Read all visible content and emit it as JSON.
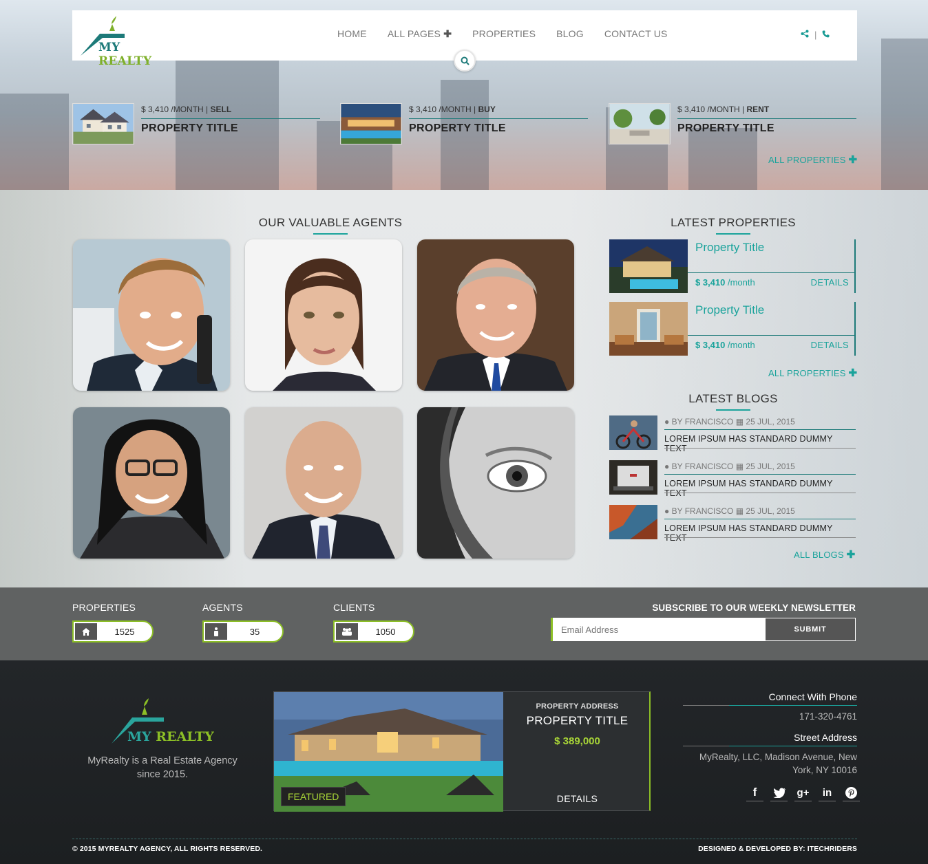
{
  "brand": {
    "my": "MY",
    "realty": "REALTY"
  },
  "nav": {
    "home": "HOME",
    "all_pages": "ALL PAGES",
    "properties": "PROPERTIES",
    "blog": "BLOG",
    "contact": "CONTACT US"
  },
  "top_properties": [
    {
      "price": "$ 3,410 /MONTH",
      "sep": " | ",
      "type": "SELL",
      "title": "PROPERTY TITLE"
    },
    {
      "price": "$ 3,410 /MONTH",
      "sep": " | ",
      "type": "BUY",
      "title": "PROPERTY TITLE"
    },
    {
      "price": "$ 3,410 /MONTH",
      "sep": " | ",
      "type": "RENT",
      "title": "PROPERTY TITLE"
    }
  ],
  "all_properties_link": "ALL PROPERTIES",
  "agents_heading": "OUR VALUABLE AGENTS",
  "latest_properties": {
    "heading": "LATEST PROPERTIES",
    "items": [
      {
        "title": "Property Title",
        "price_value": "$ 3,410",
        "price_unit": " /month",
        "details": "DETAILS"
      },
      {
        "title": "Property Title",
        "price_value": "$ 3,410",
        "price_unit": " /month",
        "details": "DETAILS"
      }
    ],
    "all_link": "ALL PROPERTIES"
  },
  "latest_blogs": {
    "heading": "LATEST BLOGS",
    "items": [
      {
        "author": "BY FRANCISCO",
        "date": "25 JUL, 2015",
        "text": "LOREM IPSUM HAS STANDARD DUMMY TEXT"
      },
      {
        "author": "BY FRANCISCO",
        "date": "25 JUL, 2015",
        "text": "LOREM IPSUM HAS STANDARD DUMMY TEXT"
      },
      {
        "author": "BY FRANCISCO",
        "date": "25 JUL, 2015",
        "text": "LOREM IPSUM HAS STANDARD DUMMY TEXT"
      }
    ],
    "all_link": "ALL BLOGS"
  },
  "stats": [
    {
      "label": "PROPERTIES",
      "value": "1525",
      "icon": "home-icon"
    },
    {
      "label": "AGENTS",
      "value": "35",
      "icon": "user-icon"
    },
    {
      "label": "CLIENTS",
      "value": "1050",
      "icon": "users-icon"
    }
  ],
  "newsletter": {
    "title": "SUBSCRIBE TO OUR WEEKLY NEWSLETTER",
    "placeholder": "Email Address",
    "submit": "SUBMIT"
  },
  "footer": {
    "tagline": "MyRealty is a Real Estate Agency since 2015.",
    "featured": {
      "badge": "FEATURED",
      "address_label": "PROPERTY ADDRESS",
      "title": "PROPERTY TITLE",
      "price": "$ 389,000",
      "details": "DETAILS"
    },
    "phone_heading": "Connect With Phone",
    "phone": "171-320-4761",
    "address_heading": "Street Address",
    "address": "MyRealty, LLC, Madison Avenue, New York, NY 10016",
    "copyright": "© 2015 MYREALTY AGENCY, ALL RIGHTS RESERVED.",
    "credit": "DESIGNED & DEVELOPED BY: ITECHRIDERS"
  },
  "colors": {
    "accent": "#1aa39b",
    "brand_green": "#8cbf26",
    "stats_band": "#606262"
  }
}
